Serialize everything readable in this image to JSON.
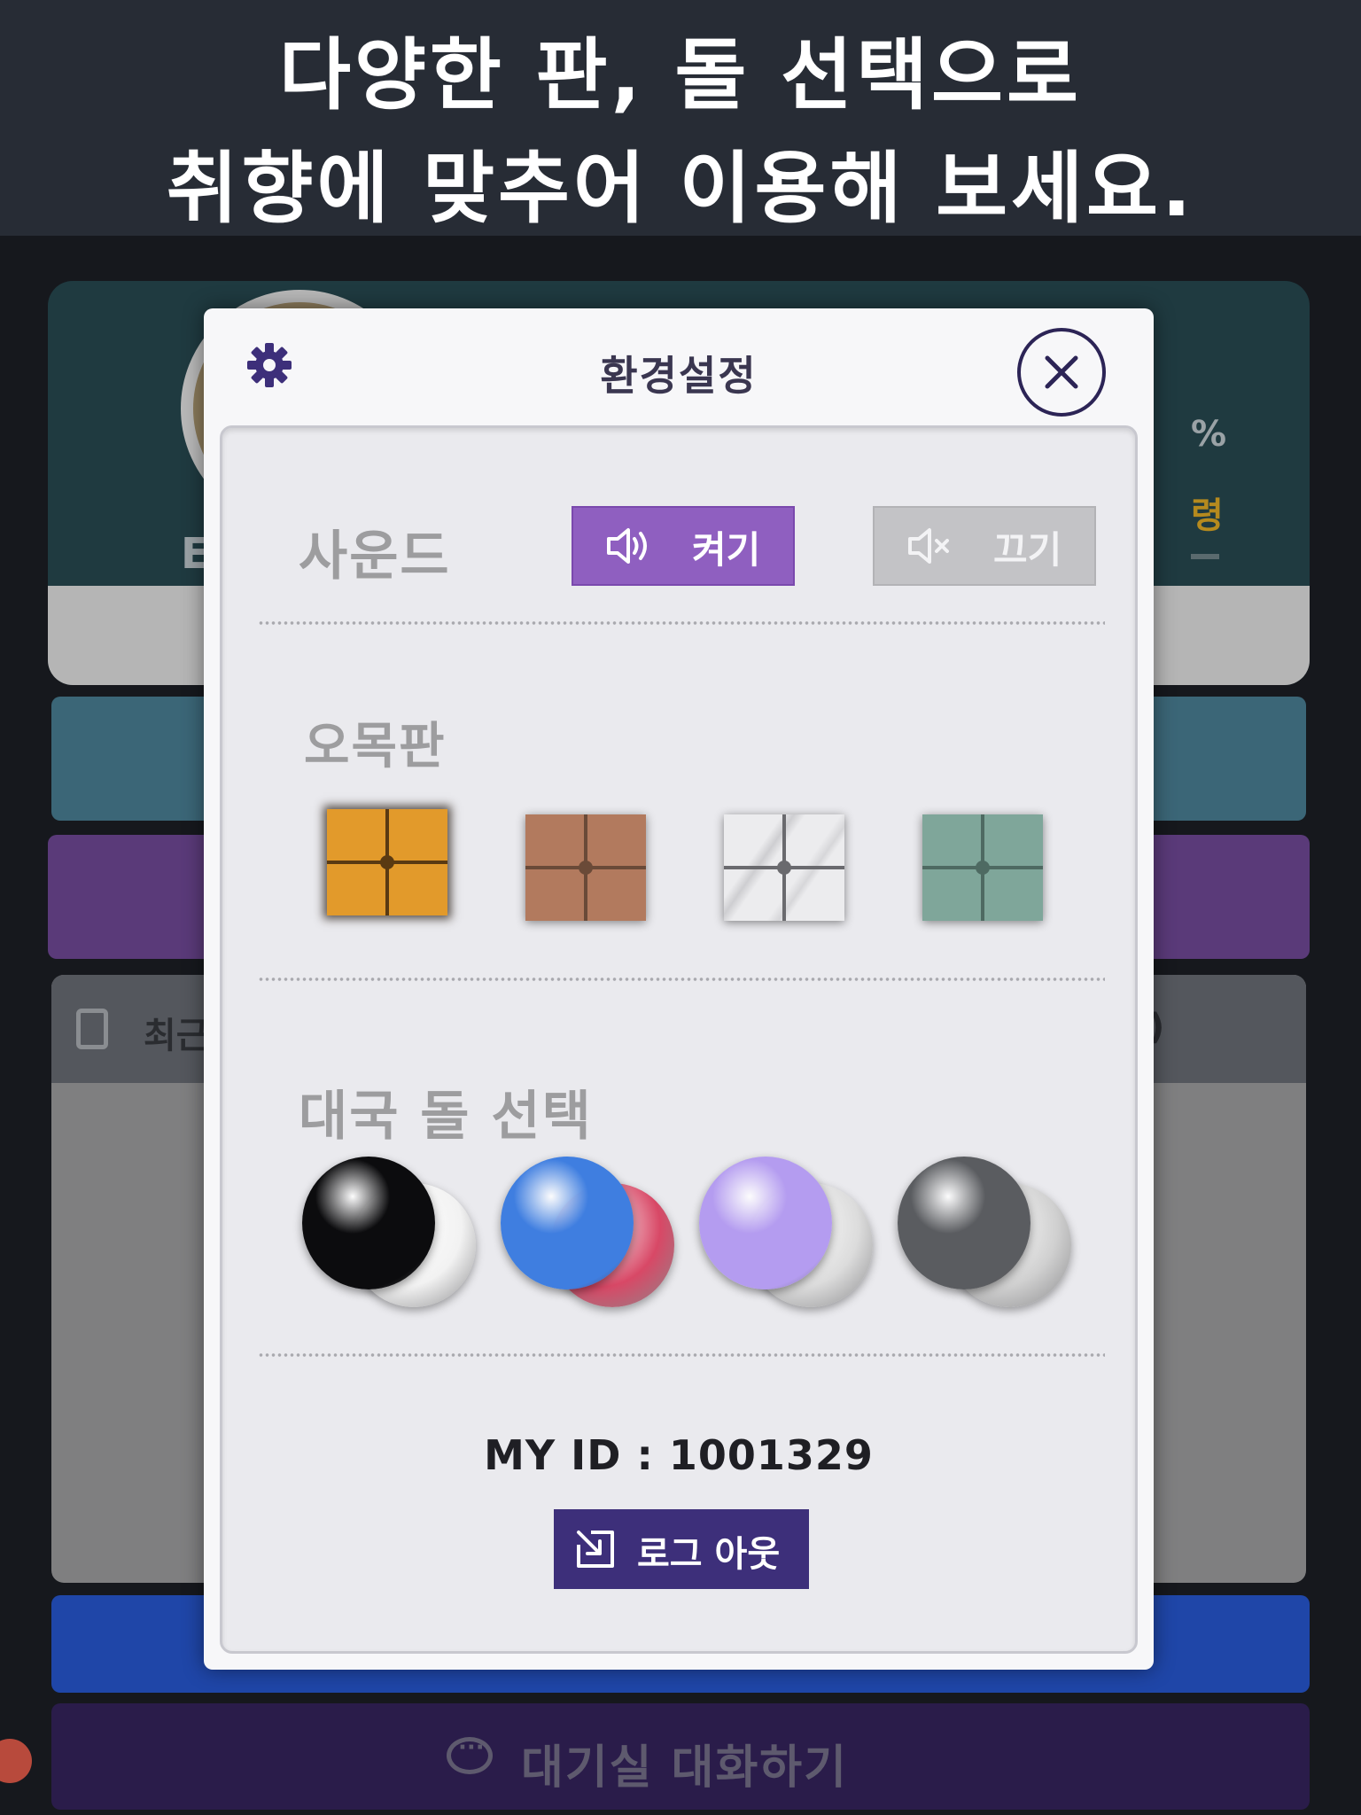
{
  "banner": {
    "line1": "다양한 판, 돌 선택으로",
    "line2": "취향에 맞추어 이용해 보세요."
  },
  "background": {
    "profile_rank_peek": "E",
    "percent_peek": "%",
    "gold_peek": "령",
    "recent_label_peek": "최근",
    "recent_right_peek": ")",
    "chat_button_label": "대기실 대화하기"
  },
  "settings": {
    "title": "환경설정",
    "icons": {
      "header": "gear-icon",
      "close": "close-icon",
      "sound_on": "speaker-on-icon",
      "sound_off": "speaker-mute-icon",
      "logout": "logout-icon"
    },
    "sound": {
      "label": "사운드",
      "on_label": "켜기",
      "off_label": "끄기",
      "selected": "on"
    },
    "board": {
      "label": "오목판",
      "options": [
        {
          "name": "yellow-wood",
          "color": "#e29a2b",
          "line": "#5a3a12",
          "selected": true
        },
        {
          "name": "brown-wood",
          "color": "#b27a5e",
          "line": "#6a4a38",
          "selected": false
        },
        {
          "name": "white-marble",
          "color": "#ececee",
          "line": "#6a6a6e",
          "selected": false
        },
        {
          "name": "sage-green",
          "color": "#7fa69a",
          "line": "#4e6a62",
          "selected": false
        }
      ]
    },
    "stones": {
      "label": "대국 돌 선택",
      "options": [
        {
          "name": "black-white-classic",
          "front": "#0c0c0e",
          "back": "#f2f2f2"
        },
        {
          "name": "blue-red-glass",
          "front": "#3f7ee0",
          "back": "#d84866"
        },
        {
          "name": "lavender-pearl",
          "front": "#b49cf0",
          "back": "#dcdcdc"
        },
        {
          "name": "granite-gray",
          "front": "#5a5c60",
          "back": "#d0d0d0"
        }
      ]
    },
    "my_id": "MY ID : 1001329",
    "logout_label": "로그 아웃",
    "colors": {
      "accent_purple": "#8f5fc0",
      "logout_navy": "#3d2f7a",
      "title": "#3a3650"
    }
  }
}
